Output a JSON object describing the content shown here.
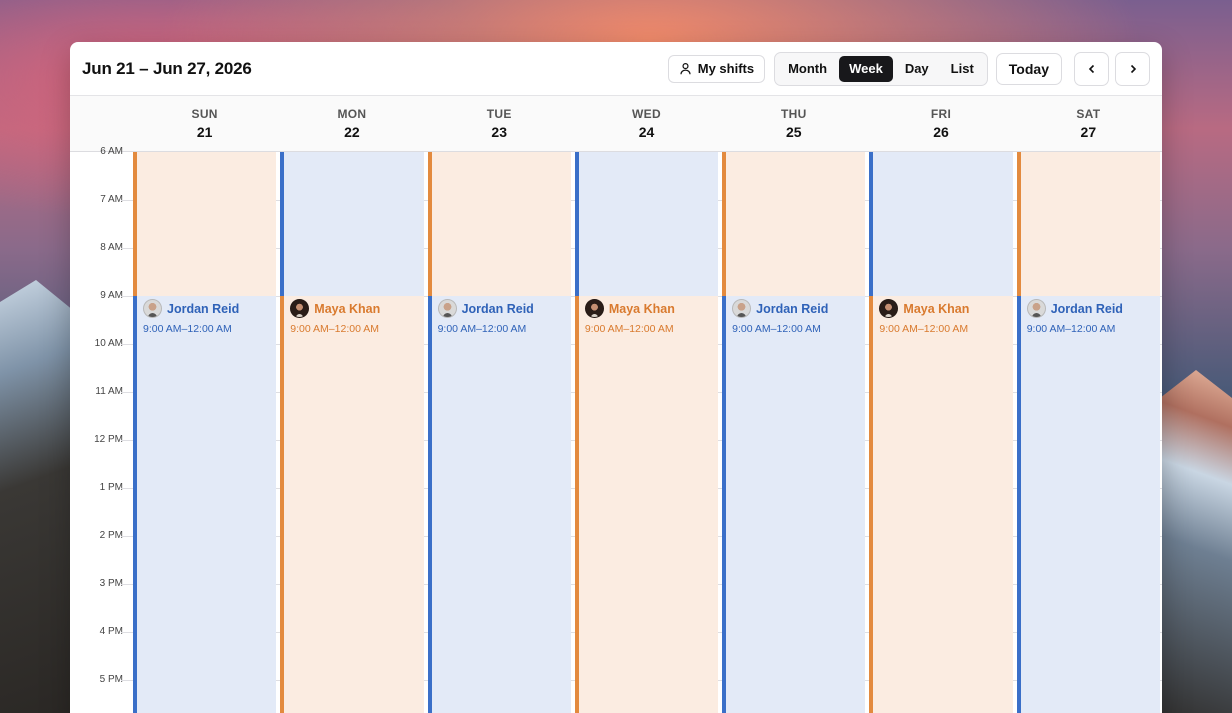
{
  "toolbar": {
    "title": "Jun 21 – Jun 27, 2026",
    "my_shifts_label": "My shifts",
    "views": [
      "Month",
      "Week",
      "Day",
      "List"
    ],
    "active_view": "Week",
    "today_label": "Today",
    "prev_icon": "chevron-left-icon",
    "next_icon": "chevron-right-icon"
  },
  "hours": [
    "6 AM",
    "7 AM",
    "8 AM",
    "9 AM",
    "10 AM",
    "11 AM",
    "12 PM",
    "1 PM",
    "2 PM",
    "3 PM",
    "4 PM",
    "5 PM"
  ],
  "days": [
    {
      "dow": "SUN",
      "num": "21",
      "early": "orange",
      "late": "blue",
      "name": "Jordan Reid",
      "time": "9:00 AM–12:00 AM",
      "avatar": "m"
    },
    {
      "dow": "MON",
      "num": "22",
      "early": "blue",
      "late": "orange",
      "name": "Maya Khan",
      "time": "9:00 AM–12:00 AM",
      "avatar": "f"
    },
    {
      "dow": "TUE",
      "num": "23",
      "early": "orange",
      "late": "blue",
      "name": "Jordan Reid",
      "time": "9:00 AM–12:00 AM",
      "avatar": "m"
    },
    {
      "dow": "WED",
      "num": "24",
      "early": "blue",
      "late": "orange",
      "name": "Maya Khan",
      "time": "9:00 AM–12:00 AM",
      "avatar": "f"
    },
    {
      "dow": "THU",
      "num": "25",
      "early": "orange",
      "late": "blue",
      "name": "Jordan Reid",
      "time": "9:00 AM–12:00 AM",
      "avatar": "m"
    },
    {
      "dow": "FRI",
      "num": "26",
      "early": "blue",
      "late": "orange",
      "name": "Maya Khan",
      "time": "9:00 AM–12:00 AM",
      "avatar": "f"
    },
    {
      "dow": "SAT",
      "num": "27",
      "early": "orange",
      "late": "blue",
      "name": "Jordan Reid",
      "time": "9:00 AM–12:00 AM",
      "avatar": "m"
    }
  ],
  "colors": {
    "blue": "#3a6fc8",
    "orange": "#e38a3e"
  }
}
